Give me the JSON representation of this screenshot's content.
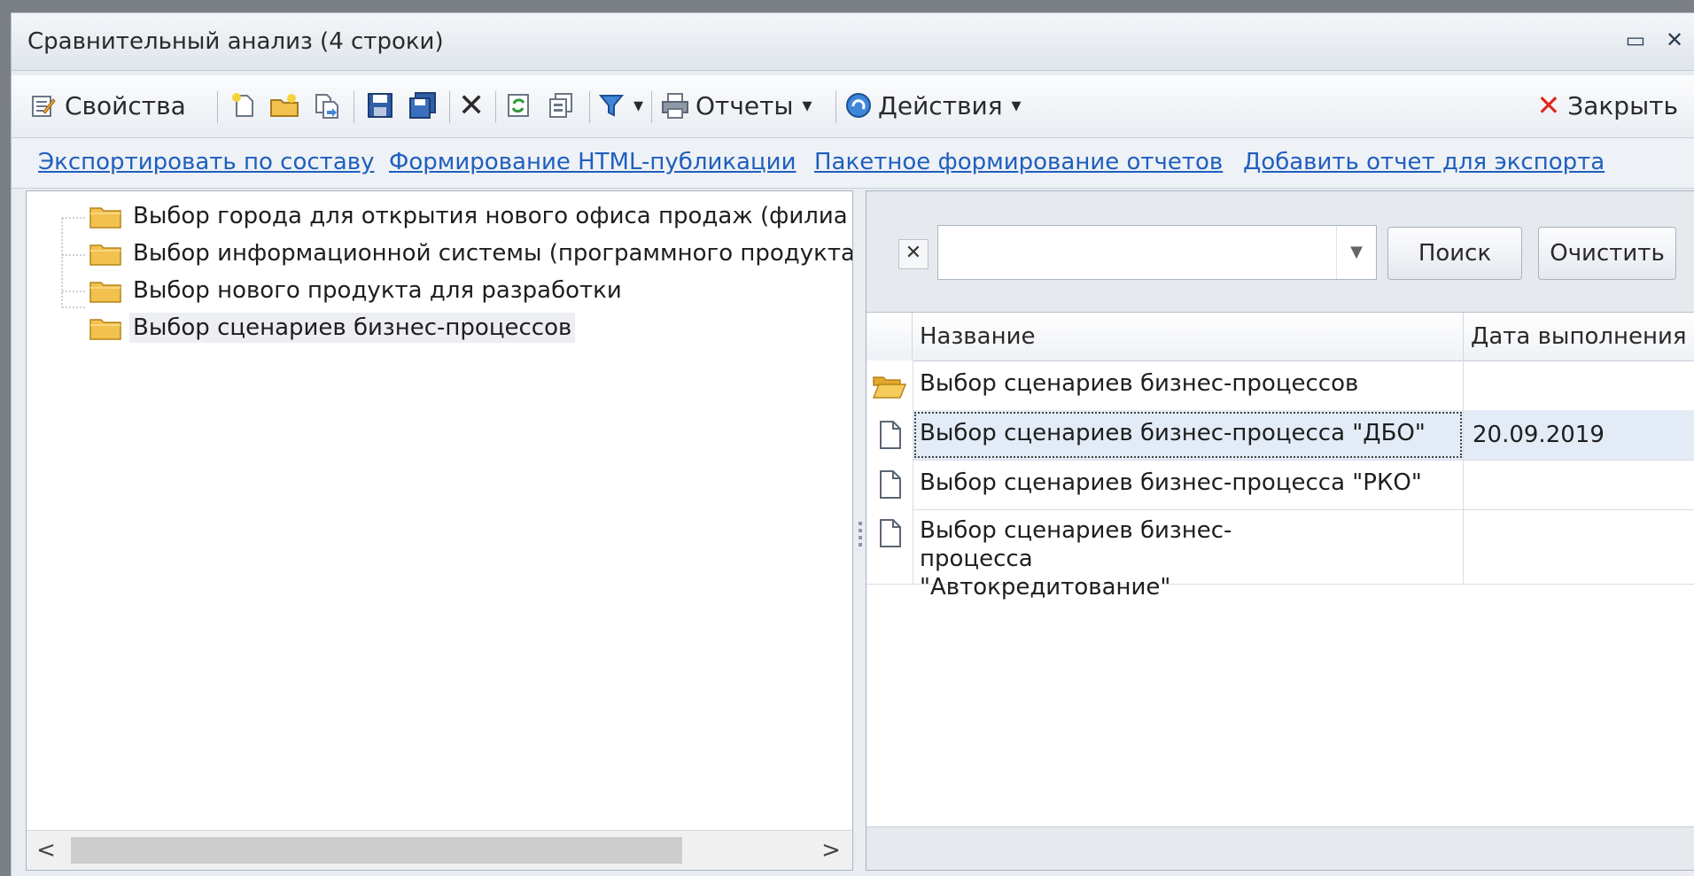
{
  "window": {
    "title": "Сравнительный анализ (4 строки)",
    "restore_glyph": "▭",
    "close_glyph": "✕"
  },
  "toolbar": {
    "properties_label": "Свойства",
    "reports_label": "Отчеты",
    "actions_label": "Действия",
    "close_label": "Закрыть",
    "dropdown_glyph": "▾",
    "delete_glyph": "✕"
  },
  "links": [
    "Экспортировать по составу",
    "Формирование HTML-публикации",
    "Пакетное формирование отчетов",
    "Добавить отчет для экспорта"
  ],
  "tree": {
    "items": [
      {
        "label": "Выбор города для открытия нового офиса продаж (филиа",
        "selected": false
      },
      {
        "label": "Выбор информационной системы (программного продукта)",
        "selected": false
      },
      {
        "label": "Выбор нового продукта для разработки",
        "selected": false
      },
      {
        "label": "Выбор сценариев бизнес-процессов",
        "selected": true
      }
    ]
  },
  "search": {
    "clear_glyph": "✕",
    "value": "",
    "dropdown_glyph": "▼",
    "search_button": "Поиск",
    "clear_button": "Очистить"
  },
  "grid": {
    "columns": [
      "Название",
      "Дата выполнения"
    ],
    "rows": [
      {
        "icon": "open-folder-icon",
        "name": "Выбор сценариев бизнес-процессов",
        "date": ""
      },
      {
        "icon": "document-icon",
        "name": "Выбор сценариев бизнес-процесса \"ДБО\"",
        "date": "20.09.2019",
        "selected": true
      },
      {
        "icon": "document-icon",
        "name": "Выбор сценариев бизнес-процесса \"РКО\"",
        "date": ""
      },
      {
        "icon": "document-icon",
        "name": "Выбор сценариев бизнес-процесса \"Автокредитование\"",
        "date": ""
      }
    ]
  },
  "scrollbar": {
    "left_arrow": "<",
    "right_arrow": ">"
  },
  "colors": {
    "link": "#1f5fbf",
    "folder": "#f2c14e",
    "close_red": "#e0261b",
    "selection": "#e3ebf6"
  }
}
